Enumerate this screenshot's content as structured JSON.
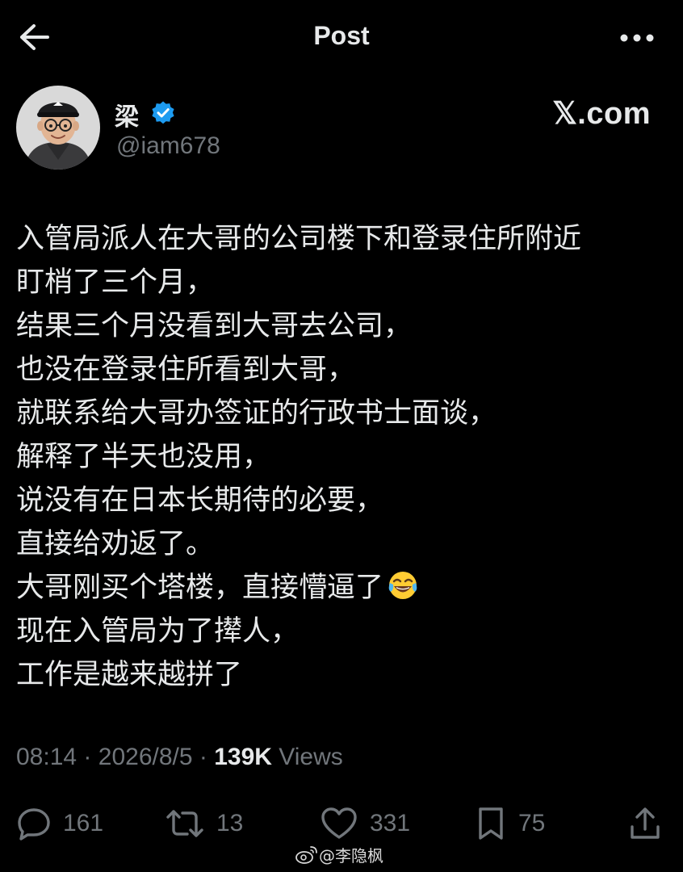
{
  "header": {
    "title": "Post",
    "back_icon": "arrow-left-icon",
    "more_icon": "more-horizontal-icon"
  },
  "author": {
    "display_name": "梁",
    "handle": "@iam678",
    "verified": true,
    "verified_color": "#1d9bf0"
  },
  "watermark": {
    "text": "𝕏.com"
  },
  "post": {
    "lines": [
      "入管局派人在大哥的公司楼下和登录住所附近",
      "盯梢了三个月，",
      "结果三个月没看到大哥去公司，",
      "也没在登录住所看到大哥，",
      "就联系给大哥办签证的行政书士面谈，",
      "解释了半天也没用，",
      "说没有在日本长期待的必要，",
      "直接给劝返了。",
      "大哥刚买个塔楼，直接懵逼了",
      "现在入管局为了撵人，",
      "工作是越来越拼了"
    ],
    "emoji": "face-with-tears-of-joy"
  },
  "meta": {
    "time": "08:14",
    "separator": "·",
    "date": "2026/8/5",
    "views_count": "139K",
    "views_label": "Views"
  },
  "actions": {
    "replies": "161",
    "reposts": "13",
    "likes": "331",
    "bookmarks": "75"
  },
  "source_watermark": {
    "text": "@李隐枫",
    "icon": "weibo-logo-icon"
  },
  "colors": {
    "background": "#000000",
    "text_primary": "#e7e9ea",
    "text_secondary": "#71767b",
    "accent": "#1d9bf0"
  }
}
